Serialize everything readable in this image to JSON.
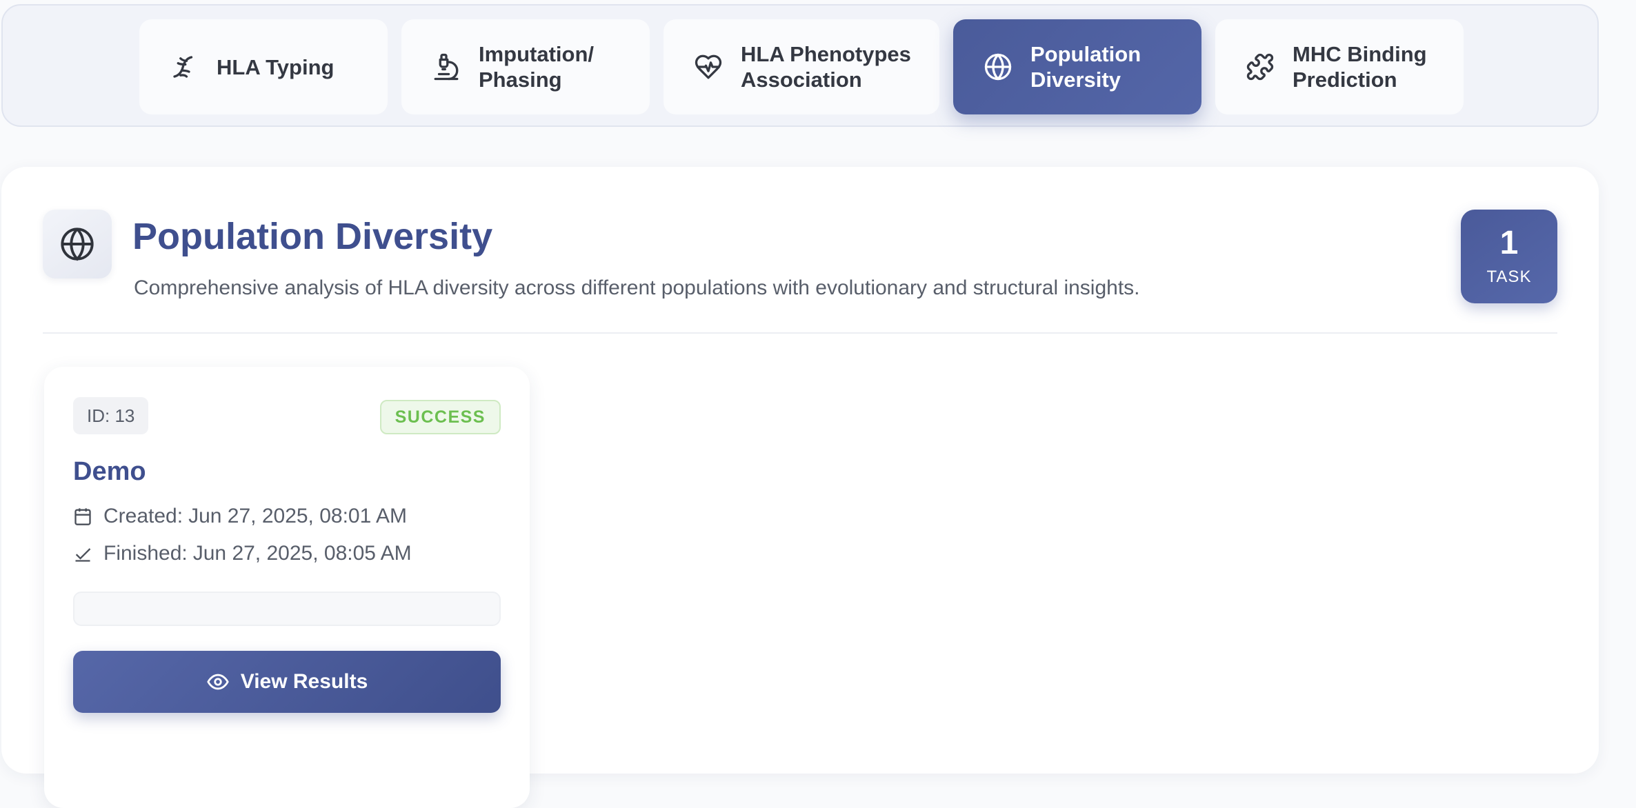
{
  "tabs": [
    {
      "label": "HLA Typing",
      "icon": "dna-icon",
      "active": false
    },
    {
      "label": "Imputation/\nPhasing",
      "icon": "microscope-icon",
      "active": false
    },
    {
      "label": "HLA Phenotypes\nAssociation",
      "icon": "heart-pulse-icon",
      "active": false
    },
    {
      "label": "Population\nDiversity",
      "icon": "globe-icon",
      "active": true
    },
    {
      "label": "MHC Binding\nPrediction",
      "icon": "puzzle-icon",
      "active": false
    }
  ],
  "section": {
    "icon": "globe-icon",
    "title": "Population Diversity",
    "description": "Comprehensive analysis of HLA diversity across different populations with evolutionary and structural insights.",
    "task_count": "1",
    "task_unit": "TASK"
  },
  "task": {
    "id": "ID: 13",
    "status": "SUCCESS",
    "name": "Demo",
    "created_label": "Created:",
    "created": "Jun 27, 2025, 08:01 AM",
    "finished_label": "Finished:",
    "finished": "Jun 27, 2025, 08:05 AM",
    "view_button": "View Results"
  },
  "colors": {
    "accent": "#4a5b9a",
    "title": "#3f4f8e",
    "success": "#6cbf50"
  }
}
